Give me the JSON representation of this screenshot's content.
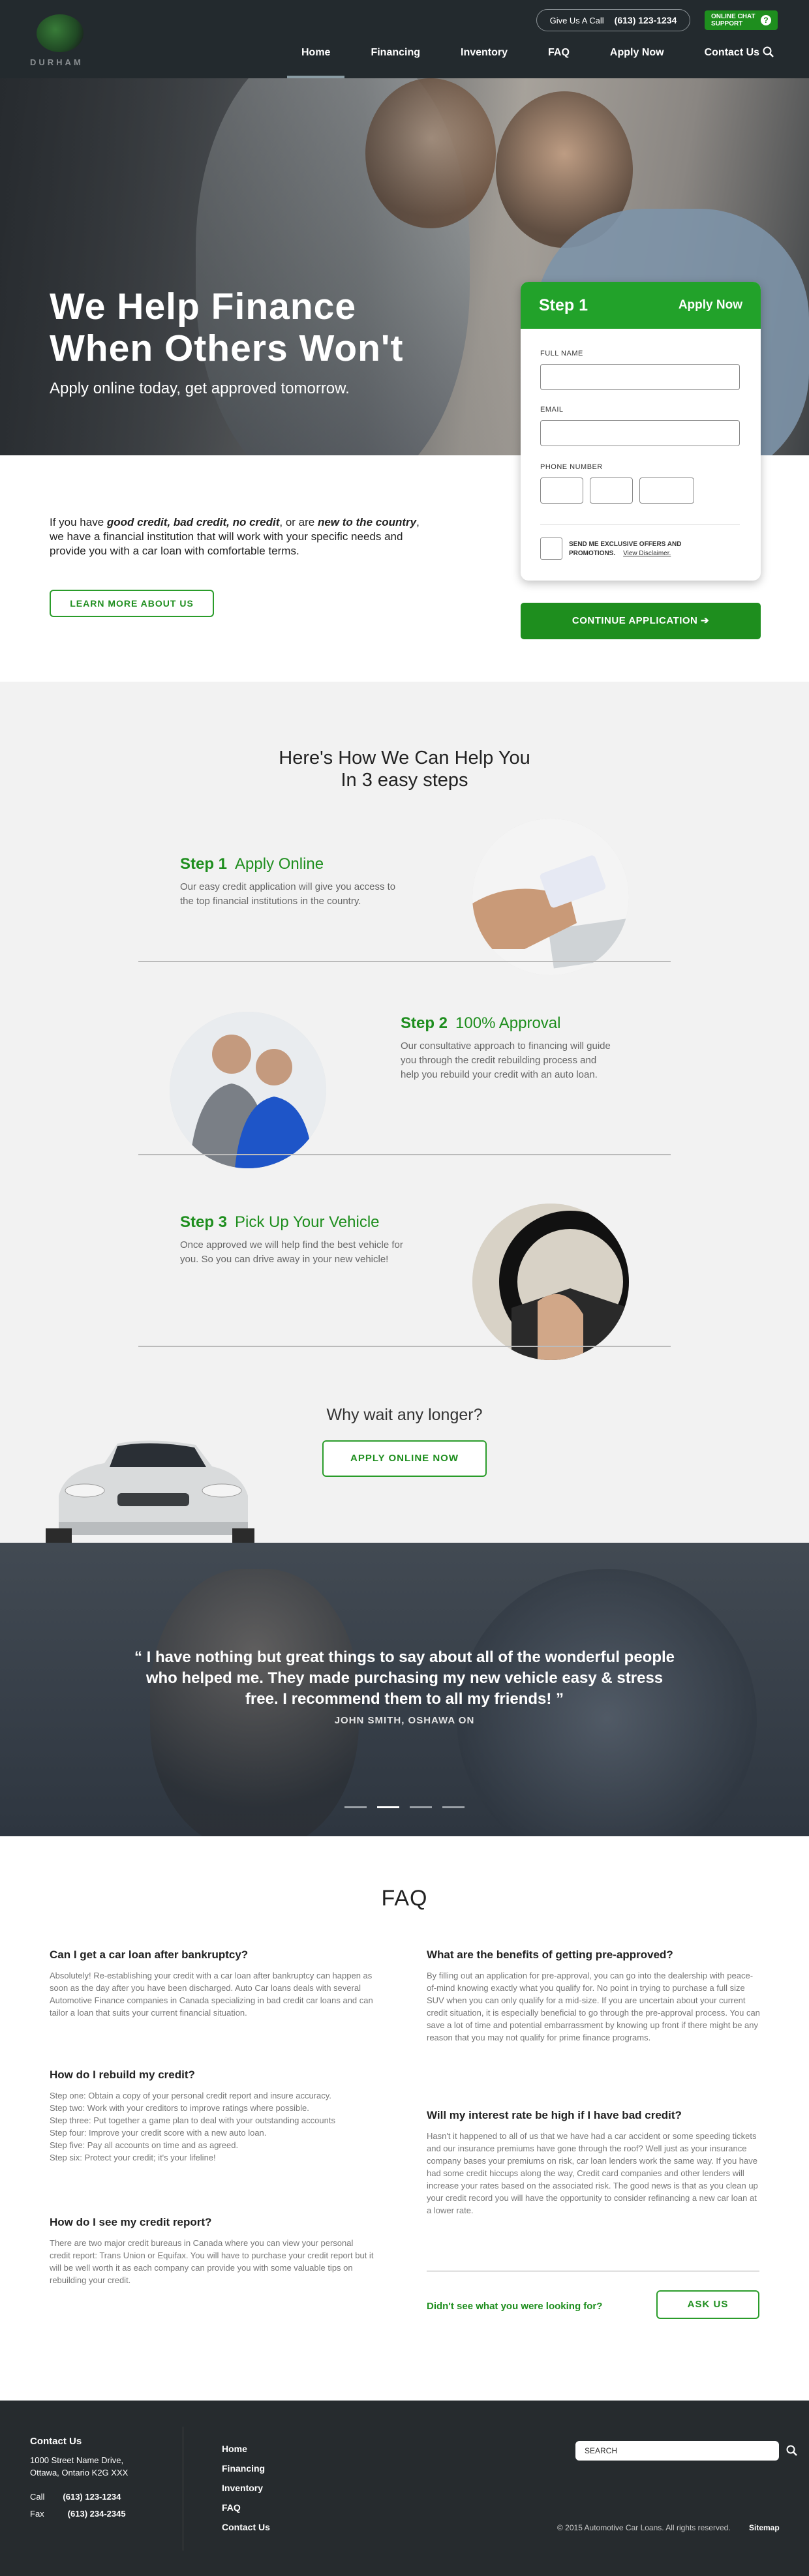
{
  "header": {
    "logo_text": "DURHAM",
    "call_label": "Give Us A Call",
    "call_phone": "(613) 123-1234",
    "chat_label_1": "ONLINE CHAT",
    "chat_label_2": "SUPPORT",
    "chat_icon": "?",
    "nav": [
      "Home",
      "Financing",
      "Inventory",
      "FAQ",
      "Apply Now",
      "Contact Us"
    ],
    "active_nav": "Home"
  },
  "hero": {
    "title_line1": "We Help Finance",
    "title_line2": "When Others Won't",
    "subtitle": "Apply online today, get approved tomorrow."
  },
  "intro": {
    "text_1": "If you have ",
    "em_1": "good credit, bad credit, no credit",
    "text_2": ", or are ",
    "em_2": "new to the country",
    "text_3": ", we have a financial institution that will work with your specific needs and provide you with a car loan with comfortable terms.",
    "learn_button": "LEARN MORE ABOUT US"
  },
  "form": {
    "step_label": "Step 1",
    "apply_label": "Apply Now",
    "full_name_label": "FULL NAME",
    "email_label": "EMAIL",
    "phone_label": "PHONE NUMBER",
    "promo_text": "SEND ME EXCLUSIVE OFFERS AND PROMOTIONS.",
    "disclaimer": "View Disclaimer.",
    "continue_button": "CONTINUE APPLICATION"
  },
  "steps": {
    "heading_1": "Here's How We Can Help You",
    "heading_2": "In 3 easy steps",
    "items": [
      {
        "num": "Step 1",
        "title": "Apply Online",
        "text": "Our easy credit application will give you access to the top financial institutions in the country."
      },
      {
        "num": "Step 2",
        "title": "100% Approval",
        "text": "Our consultative approach to financing will guide you through the credit rebuilding process and help you rebuild your credit with an auto loan."
      },
      {
        "num": "Step 3",
        "title": "Pick Up Your Vehicle",
        "text": "Once approved we will help find the best vehicle for you. So you can drive away in your new vehicle!"
      }
    ],
    "wait_heading": "Why wait any longer?",
    "apply_button": "APPLY ONLINE NOW"
  },
  "testimonial": {
    "quote": "“ I have nothing but great things to say about all of the wonderful people who helped me. They made purchasing my new vehicle easy & stress free. I recommend them to all my friends! ”",
    "author": "JOHN SMITH,   OSHAWA ON",
    "slides": 4,
    "active_slide": 2
  },
  "faq": {
    "heading": "FAQ",
    "left": [
      {
        "q": "Can I get a car loan after bankruptcy?",
        "a": "Absolutely! Re-establishing your credit with a car loan after bankruptcy can happen as soon as the day after you have been discharged. Auto Car loans deals with several Automotive Finance companies in Canada specializing in bad credit car loans and can tailor a loan that suits your current financial situation."
      },
      {
        "q": "How do I rebuild my credit?",
        "a": "Step one: Obtain a copy of your personal credit report and insure accuracy.\nStep two: Work with your creditors to improve ratings where possible.\nStep three: Put together a game plan to deal with your outstanding accounts\nStep four: Improve your credit score with a new auto loan.\nStep five: Pay all accounts on time and as agreed.\nStep six: Protect your credit; it's your lifeline!"
      },
      {
        "q": "How do I see my credit report?",
        "a": "There are two major credit bureaus in Canada where you can view your personal credit report: Trans Union or Equifax. You will have to purchase your credit report but it will be well worth it as each company can provide you with some valuable tips on rebuilding your credit."
      }
    ],
    "right": [
      {
        "q": "What are the benefits of getting pre-approved?",
        "a": "By filling out an application for pre-approval, you can go into the dealership with peace-of-mind knowing exactly what you qualify for. No point in trying to purchase a full size SUV when you can only qualify for a mid-size. If you are uncertain about your current credit situation, it is especially beneficial to go through the pre-approval process. You can save a lot of time and potential embarrassment by knowing up front if there might be any reason that you may not qualify for prime finance programs."
      },
      {
        "q": "Will my interest rate be high if I have bad credit?",
        "a": "Hasn't it happened to all of us that we have had a car accident or some speeding tickets and our insurance premiums have gone through the roof? Well just as your insurance company bases your premiums on risk, car loan lenders work the same way. If you have had some credit hiccups along the way, Credit card companies and other lenders will increase your rates based on the associated risk. The good news is that as you clean up your credit record you will have the opportunity to consider refinancing a new car loan at a lower rate."
      }
    ],
    "not_see": "Didn't see what you were looking for?",
    "ask_button": "ASK US"
  },
  "footer": {
    "contact_title": "Contact Us",
    "address_1": "1000 Street Name Drive,",
    "address_2": "Ottawa, Ontario  K2G XXX",
    "call_label": "Call",
    "call_number": "(613) 123-1234",
    "fax_label": "Fax",
    "fax_number": "(613) 234-2345",
    "links": [
      "Home",
      "Financing",
      "Inventory",
      "FAQ",
      "Contact Us"
    ],
    "search_placeholder": "SEARCH",
    "copyright": "© 2015 Automotive Car Loans. All rights reserved.",
    "sitemap": "Sitemap"
  },
  "colors": {
    "brand_green": "#1e8e1e",
    "header_bg": "#232a2e",
    "footer_bg": "#262b2e"
  }
}
